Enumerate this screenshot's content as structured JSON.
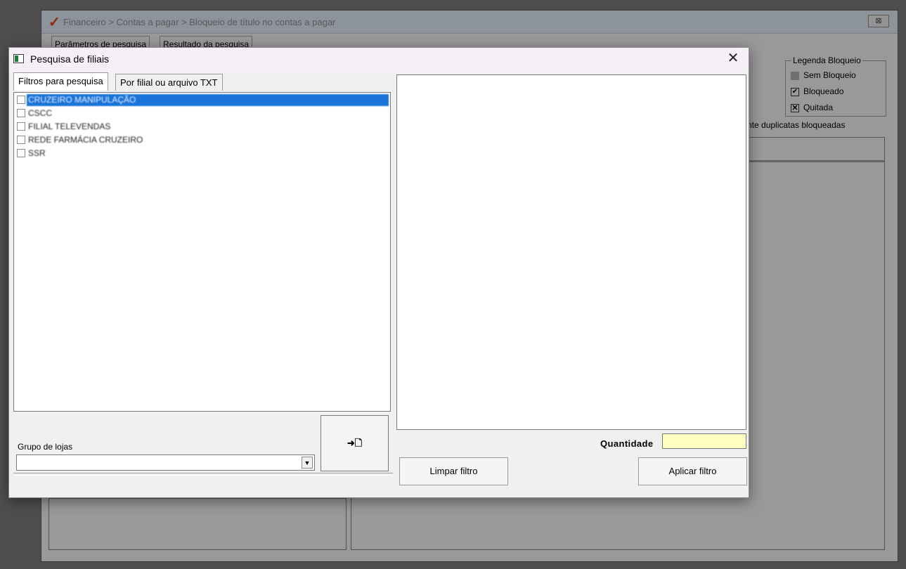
{
  "background_window": {
    "breadcrumb": "Financeiro > Contas a pagar > Bloqueio de título no contas a pagar",
    "tabs": [
      {
        "label": "Parâmetros de pesquisa"
      },
      {
        "label": "Resultado da pesquisa"
      }
    ],
    "legend": {
      "title": "Legenda Bloqueio",
      "items": [
        {
          "label": "Sem Bloqueio"
        },
        {
          "label": "Bloqueado"
        },
        {
          "label": "Quitada"
        }
      ]
    },
    "duplicates_text": "nte duplicatas bloqueadas"
  },
  "dialog": {
    "title": "Pesquisa de filiais",
    "close_symbol": "✕",
    "tabs": [
      {
        "label": "Filtros para pesquisa",
        "active": true
      },
      {
        "label": "Por filial ou arquivo TXT",
        "active": false
      }
    ],
    "branches": [
      {
        "label": "CRUZEIRO MANIPULAÇÃO",
        "checked": false,
        "selected": true
      },
      {
        "label": "CSCC",
        "checked": false,
        "selected": false
      },
      {
        "label": "FILIAL TELEVENDAS",
        "checked": false,
        "selected": false
      },
      {
        "label": "REDE FARMÁCIA CRUZEIRO",
        "checked": false,
        "selected": false
      },
      {
        "label": "SSR",
        "checked": false,
        "selected": false
      }
    ],
    "store_group": {
      "label": "Grupo de lojas",
      "value": ""
    },
    "export_button_symbol": "➜🗋",
    "quantity": {
      "label": "Quantidade",
      "value": ""
    },
    "buttons": {
      "clear": "Limpar filtro",
      "apply": "Aplicar filtro"
    },
    "colors": {
      "selection": "#1a73d8",
      "quantity_field": "#ffffc0",
      "title_bar": "#f7eff8"
    }
  }
}
